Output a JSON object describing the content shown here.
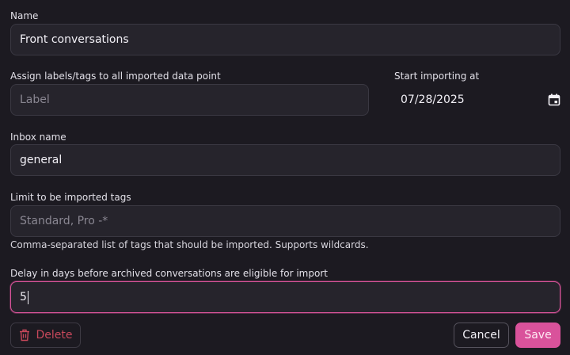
{
  "fields": {
    "name": {
      "label": "Name",
      "value": "Front conversations"
    },
    "labels": {
      "label": "Assign labels/tags to all imported data point",
      "placeholder": "Label"
    },
    "start": {
      "label": "Start importing at",
      "value": "07/28/2025"
    },
    "inbox": {
      "label": "Inbox name",
      "value": "general"
    },
    "tags": {
      "label": "Limit to be imported tags",
      "placeholder": "Standard, Pro -*",
      "hint": "Comma-separated list of tags that should be imported. Supports wildcards."
    },
    "delay": {
      "label": "Delay in days before archived conversations are eligible for import",
      "value": "5"
    }
  },
  "actions": {
    "delete_label": "Delete",
    "cancel_label": "Cancel",
    "save_label": "Save"
  },
  "icons": {
    "delete": "trash-icon",
    "date": "calendar-icon"
  },
  "colors": {
    "background": "#1c1a21",
    "input_bg": "#26242c",
    "border": "#3a3842",
    "focus_border": "#d9549a",
    "danger": "#c8485b",
    "primary": "#d9529b"
  }
}
